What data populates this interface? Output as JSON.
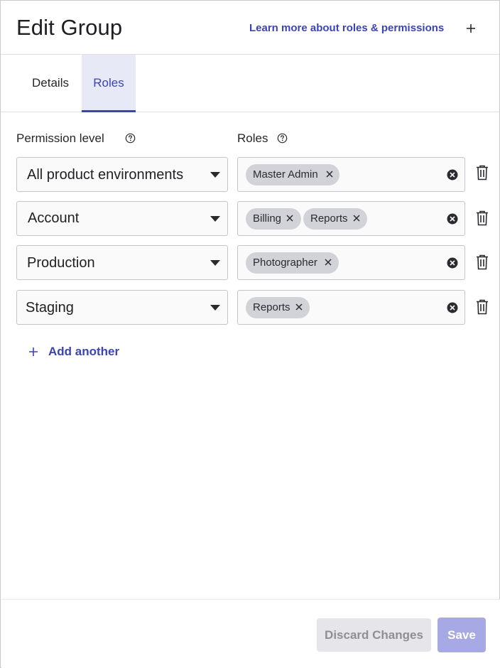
{
  "header": {
    "title": "Edit Group",
    "learn_link": "Learn more about roles & permissions",
    "close_icon": "plus-icon"
  },
  "tabs": [
    {
      "label": "Details",
      "active": false
    },
    {
      "label": "Roles",
      "active": true
    }
  ],
  "columns": {
    "permission_label": "Permission level",
    "roles_label": "Roles",
    "help_icon": "question-circle-icon"
  },
  "rows": [
    {
      "permission": "All product environments",
      "roles": [
        "Master Admin"
      ]
    },
    {
      "permission": "Account",
      "roles": [
        "Billing",
        "Reports"
      ]
    },
    {
      "permission": "Production",
      "roles": [
        "Photographer"
      ]
    },
    {
      "permission": "Staging",
      "roles": [
        "Reports"
      ]
    }
  ],
  "add_another": "Add another",
  "footer": {
    "discard_label": "Discard Changes",
    "save_label": "Save"
  },
  "colors": {
    "accent": "#3b44b5",
    "tab_active_bg": "#e8e9f7",
    "chip_bg": "#d2d3d9",
    "save_bg": "#a6a9e4",
    "discard_bg": "#e6e6ea"
  }
}
